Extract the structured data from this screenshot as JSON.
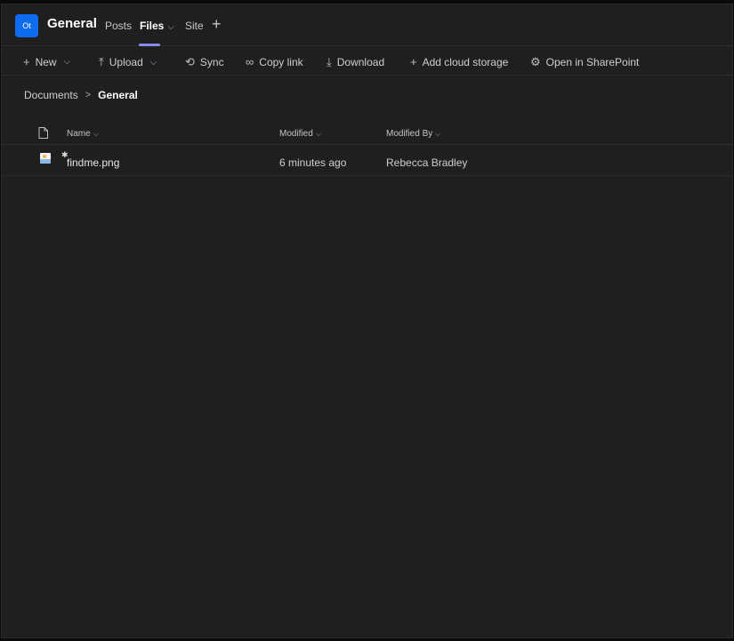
{
  "header": {
    "team_avatar": "Ot",
    "channel": "General",
    "tabs": [
      {
        "label": "Posts"
      },
      {
        "label": "Files"
      },
      {
        "label": "Site"
      }
    ],
    "files_chevron": "⌵",
    "add_tab": "+"
  },
  "toolbar": {
    "new": "New",
    "upload": "Upload",
    "sync": "Sync",
    "copy_link": "Copy link",
    "download": "Download",
    "add_cloud": "Add cloud storage",
    "open_sharepoint": "Open in SharePoint"
  },
  "breadcrumb": {
    "root": "Documents",
    "current": "General"
  },
  "table": {
    "columns": {
      "name": "Name",
      "modified": "Modified",
      "modified_by": "Modified By"
    },
    "rows": [
      {
        "name": "findme.png",
        "modified": "6 minutes ago",
        "modified_by": "Rebecca Bradley"
      }
    ]
  },
  "colors": {
    "background": "#1f1f1f",
    "accent": "#0f6cf0",
    "tab_underline": "#8b8cf0"
  }
}
